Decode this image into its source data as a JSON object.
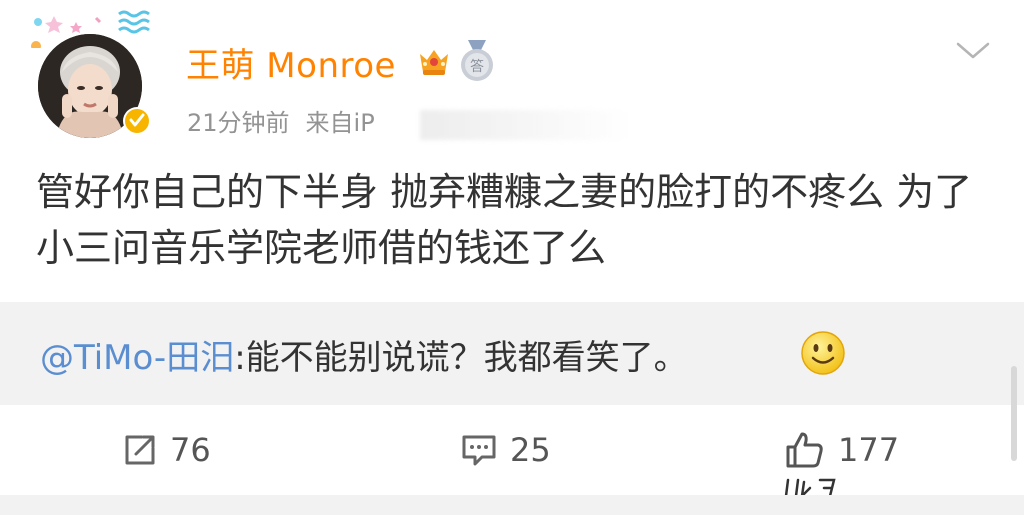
{
  "post": {
    "username": "王萌 Monroe",
    "time": "21分钟前",
    "source_prefix": "来自iP",
    "text": "管好你自己的下半身 抛弃糟糠之妻的脸打的不疼么 为了小三问音乐学院老师借的钱还了么"
  },
  "repost": {
    "mention": "@TiMo-田汨",
    "text": ":能不能别说谎？我都看笑了。"
  },
  "actions": {
    "repost_count": "76",
    "comment_count": "25",
    "like_count": "177"
  },
  "colors": {
    "username": "#ff8200",
    "mention": "#5b8ed0",
    "repost_bg": "#f2f2f2",
    "text": "#333333",
    "meta": "#939393"
  },
  "icons": {
    "verified": "verified-badge-icon",
    "member": "crown-member-icon",
    "medal": "medal-icon",
    "more": "chevron-down-icon",
    "repost": "share-icon",
    "comment": "comment-icon",
    "like": "thumbs-up-icon",
    "emoji": "smiley-emoji-icon"
  }
}
